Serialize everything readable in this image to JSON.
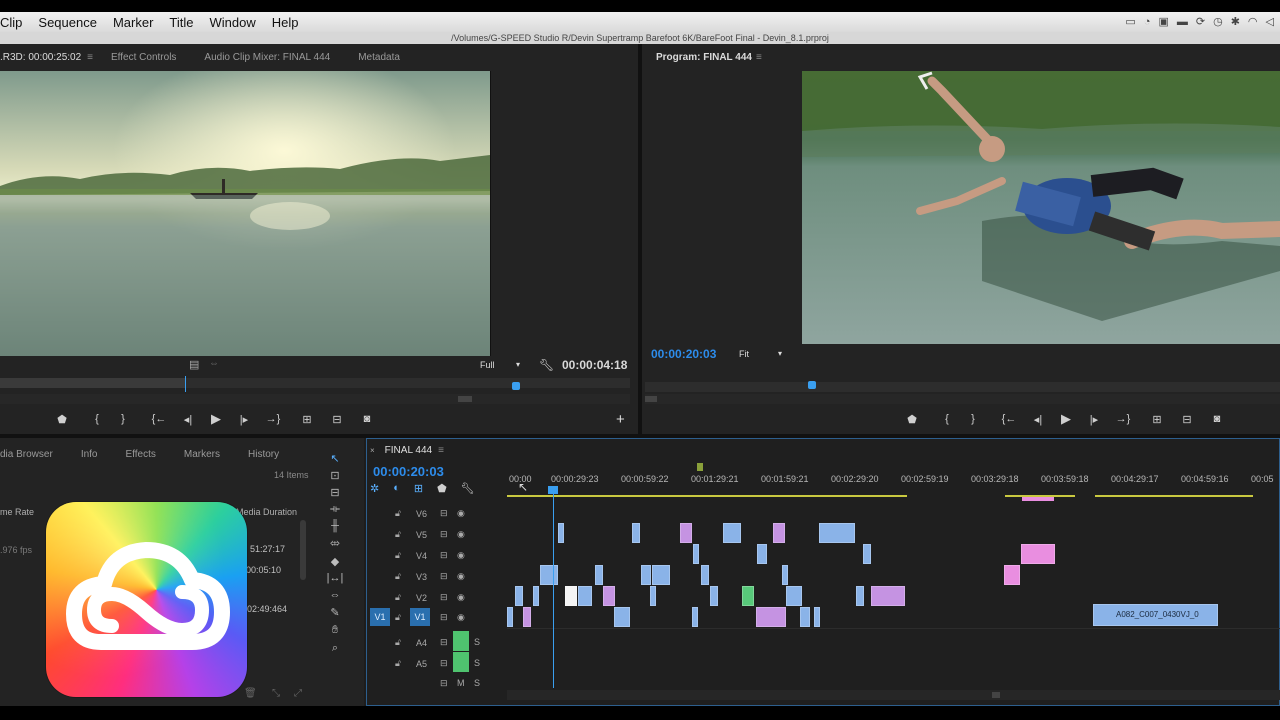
{
  "menubar": {
    "items": [
      "Clip",
      "Sequence",
      "Marker",
      "Title",
      "Window",
      "Help"
    ]
  },
  "path_title": "/Volumes/G-SPEED Studio R/Devin Supertramp Barefoot 6K/BareFoot Final - Devin_8.1.prproj",
  "source_panel": {
    "tabs": [
      ".R3D: 00:00:25:02",
      "Effect Controls",
      "Audio Clip Mixer: FINAL 444",
      "Metadata"
    ],
    "resolution": "Full",
    "duration": "00:00:04:18"
  },
  "program_panel": {
    "tab": "Program: FINAL 444",
    "timecode": "00:00:20:03",
    "fit": "Fit"
  },
  "project_panel": {
    "tabs": [
      "dia Browser",
      "Info",
      "Effects",
      "Markers",
      "History"
    ],
    "items_count": "14 Items",
    "col_frame_rate": "me Rate",
    "col_media_duration": "Media Duration",
    "fps": ".976 fps",
    "durations": [
      "51:27:17",
      "00:05:10",
      "02:49:464"
    ]
  },
  "timeline": {
    "tab": "FINAL 444",
    "timecode": "00:00:20:03",
    "ruler_labels": [
      "00:00",
      "00:00:29:23",
      "00:00:59:22",
      "00:01:29:21",
      "00:01:59:21",
      "00:02:29:20",
      "00:02:59:19",
      "00:03:29:18",
      "00:03:59:18",
      "00:04:29:17",
      "00:04:59:16",
      "00:05"
    ],
    "tracks": [
      {
        "name": "V6"
      },
      {
        "name": "V5"
      },
      {
        "name": "V4"
      },
      {
        "name": "V3"
      },
      {
        "name": "V2"
      },
      {
        "name": "V1"
      },
      {
        "name": "A4"
      },
      {
        "name": "A5"
      }
    ],
    "src_patch": "V1",
    "master_m": "M",
    "master_s": "S",
    "solo": "S",
    "clip_label": "A082_C007_0430VJ_0"
  },
  "colors": {
    "accent": "#2d8ceb",
    "clip_blue": "#8ab3e8",
    "clip_purple": "#c593e2",
    "clip_pink": "#e98ee0",
    "clip_green": "#58c97a"
  },
  "icons": [
    "creative-cloud-logo",
    "wrench-icon",
    "camera-icon",
    "play-icon",
    "plus-icon"
  ]
}
